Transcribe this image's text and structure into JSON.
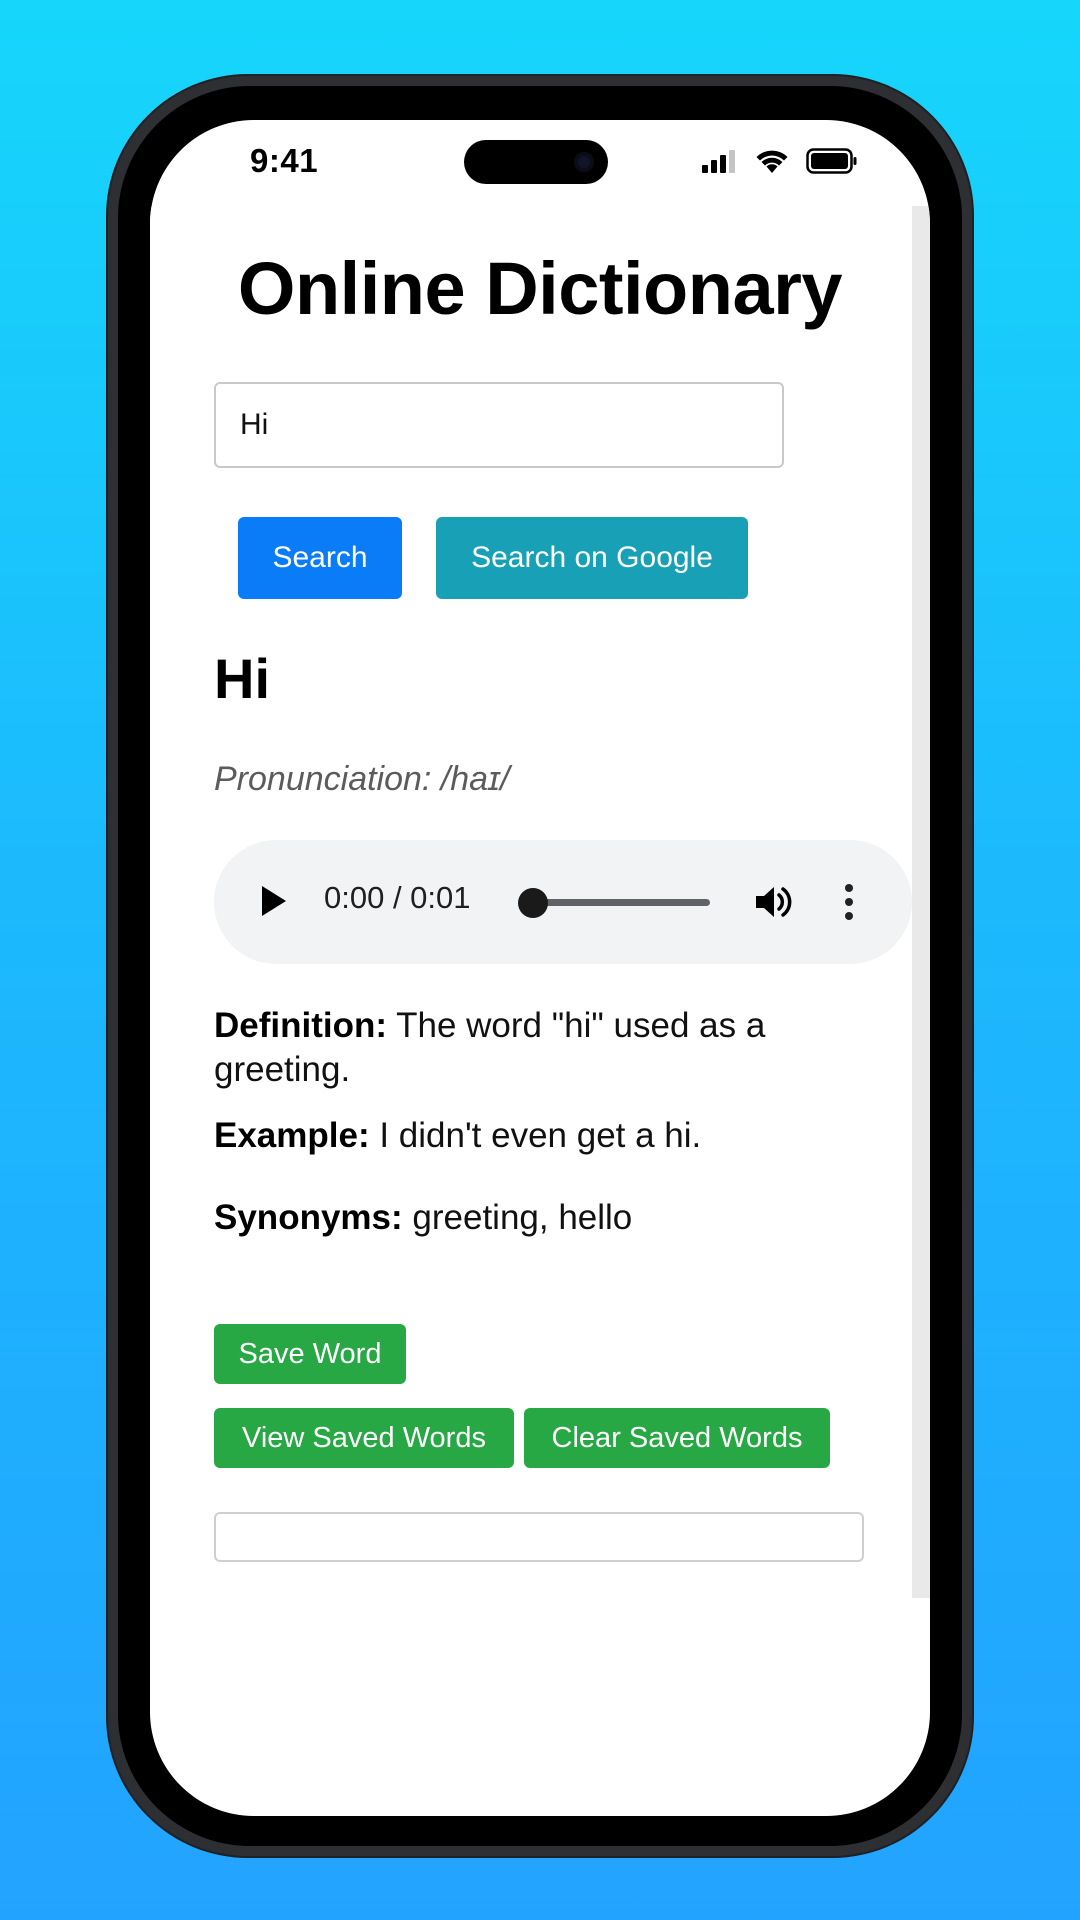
{
  "status_bar": {
    "time": "9:41"
  },
  "app": {
    "title": "Online Dictionary"
  },
  "search": {
    "value": "Hi",
    "search_label": "Search",
    "google_label": "Search on Google"
  },
  "entry": {
    "word": "Hi",
    "pronunciation": "Pronunciation: /haɪ/",
    "definition_label": "Definition:",
    "definition": "The word \"hi\" used as a greeting.",
    "example_label": "Example:",
    "example": "I didn't even get a hi.",
    "synonyms_label": "Synonyms:",
    "synonyms": "greeting, hello"
  },
  "audio": {
    "time": "0:00 / 0:01",
    "progress": 0
  },
  "actions": {
    "save_label": "Save Word",
    "view_label": "View Saved Words",
    "clear_label": "Clear Saved Words"
  },
  "colors": {
    "primary": "#0a7cf8",
    "info": "#18a0b6",
    "success": "#27a844",
    "background_top": "#16d6fb",
    "background_bottom": "#22a3ff"
  }
}
